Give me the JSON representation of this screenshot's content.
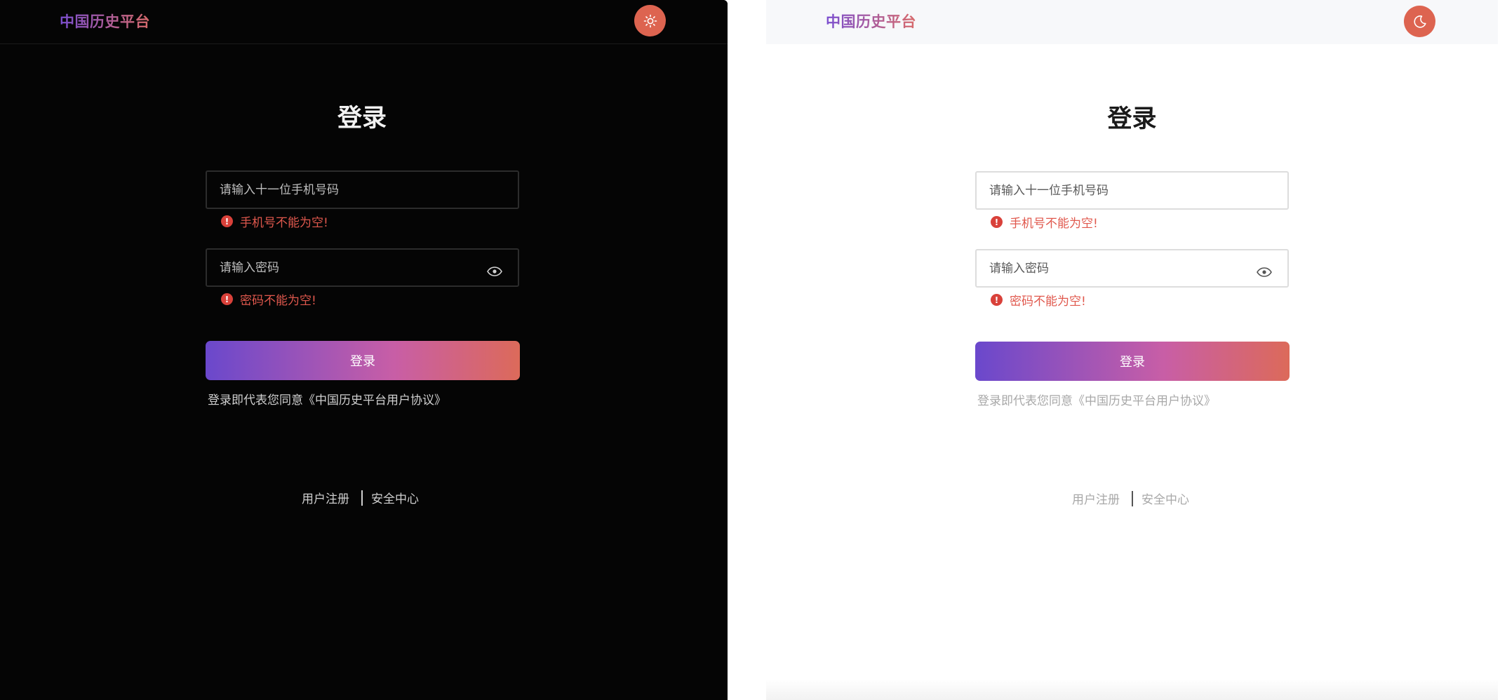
{
  "dark_panel": {
    "logo": "中国历史平台",
    "theme_toggle_icon": "sun-icon",
    "title": "登录",
    "phone": {
      "placeholder": "请输入十一位手机号码",
      "value": "",
      "error": "手机号不能为空!"
    },
    "password": {
      "placeholder": "请输入密码",
      "value": "",
      "error": "密码不能为空!"
    },
    "submit_label": "登录",
    "agreement_prefix": "登录即代表您同意",
    "agreement_link": "《中国历史平台用户协议》",
    "footer": {
      "register": "用户注册",
      "security": "安全中心"
    }
  },
  "light_panel": {
    "logo": "中国历史平台",
    "theme_toggle_icon": "moon-icon",
    "title": "登录",
    "phone": {
      "placeholder": "请输入十一位手机号码",
      "value": "",
      "error": "手机号不能为空!"
    },
    "password": {
      "placeholder": "请输入密码",
      "value": "",
      "error": "密码不能为空!"
    },
    "submit_label": "登录",
    "agreement_prefix": "登录即代表您同意",
    "agreement_link": "《中国历史平台用户协议》",
    "footer": {
      "register": "用户注册",
      "security": "安全中心"
    }
  },
  "colors": {
    "accent": "#dd6450",
    "error": "#e0584d",
    "gradient_start": "#6a48cc",
    "gradient_end": "#dc6a5a",
    "dark_bg": "#050505",
    "light_header_bg": "#f7f8fa"
  }
}
